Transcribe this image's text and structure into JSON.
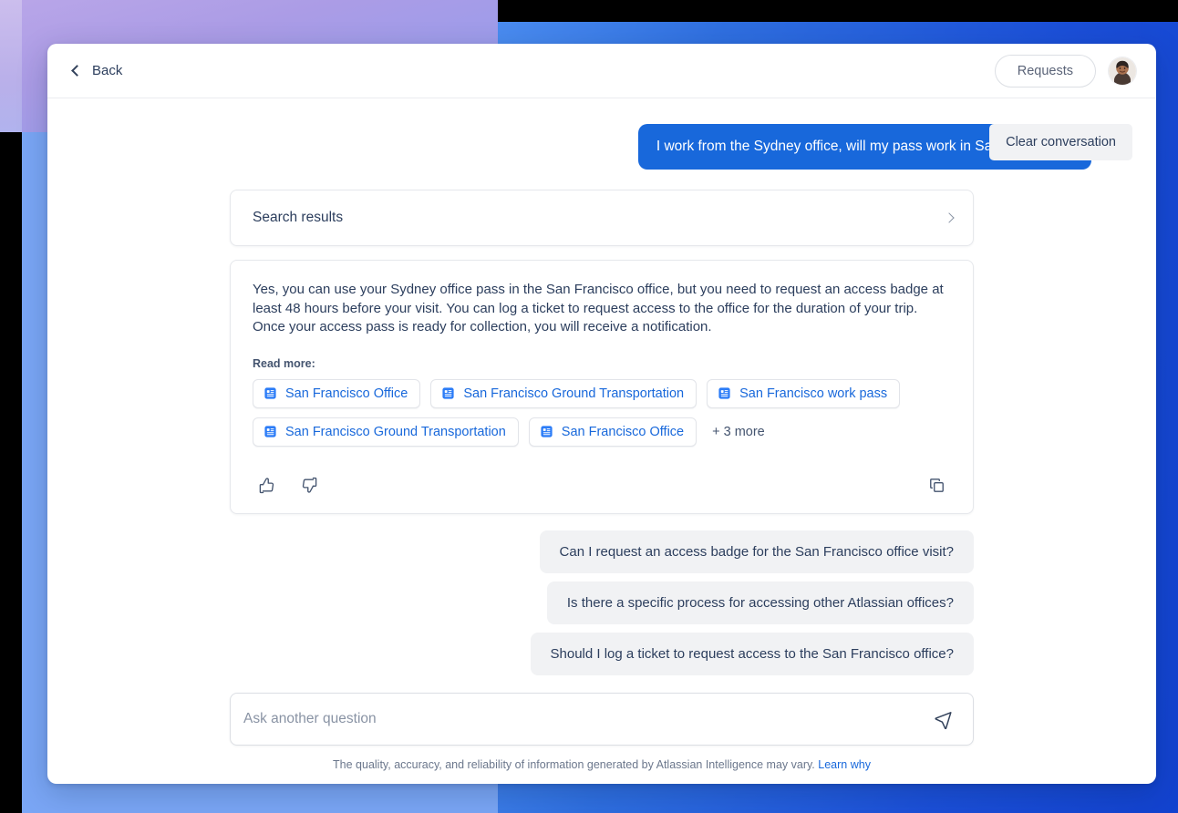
{
  "header": {
    "back_label": "Back",
    "requests_label": "Requests",
    "back_icon": "chevron-left-icon",
    "avatar_icon": "user-avatar"
  },
  "conversation": {
    "clear_label": "Clear conversation",
    "user_message": "I work from the Sydney office, will my pass work in San Francisco?",
    "search_results_card": {
      "title": "Search results",
      "expand_icon": "chevron-right-icon"
    },
    "answer": {
      "text": "Yes, you can use your Sydney office pass in the San Francisco office, but you need to request an access badge at least 48 hours before your visit. You can log a ticket to request access to the office for the duration of your trip. Once your access pass is ready for collection, you will receive a notification.",
      "read_more_label": "Read more:",
      "sources": [
        "San Francisco Office",
        "San Francisco Ground Transportation",
        "San Francisco work pass",
        "San Francisco Ground Transportation",
        "San Francisco Office"
      ],
      "more_label": "+ 3 more",
      "source_icon": "confluence-page-icon",
      "actions": {
        "thumbs_up": "thumbs-up-icon",
        "thumbs_down": "thumbs-down-icon",
        "copy": "copy-icon"
      }
    },
    "suggestions": [
      "Can I request an access badge for the San Francisco office visit?",
      "Is there a specific process for accessing other Atlassian offices?",
      "Should I log a ticket to request access to the San Francisco office?"
    ]
  },
  "composer": {
    "placeholder": "Ask another question",
    "value": "",
    "send_icon": "send-icon"
  },
  "footer": {
    "disclaimer": "The quality, accuracy, and reliability of information generated by Atlassian Intelligence may vary.",
    "link_label": "Learn why"
  },
  "colors": {
    "accent_blue": "#1868db",
    "text_primary": "#2c3e5d",
    "chip_bg": "#f1f2f4",
    "background_purple": "#ab9ce6",
    "background_blue": "#2f6fe0"
  }
}
